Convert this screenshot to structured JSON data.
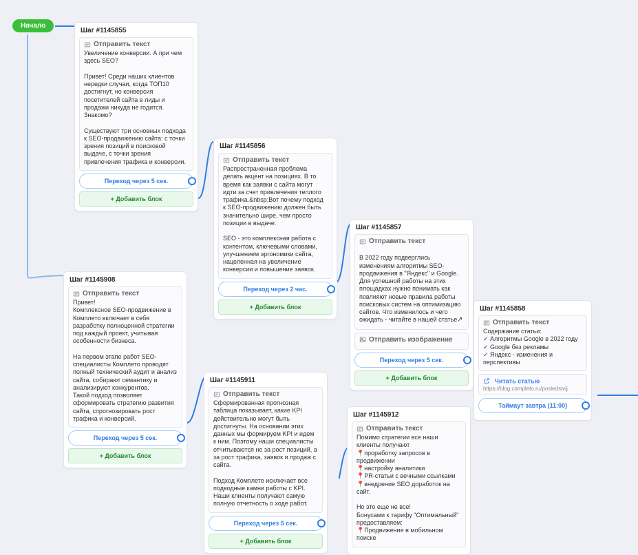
{
  "start_label": "Начало",
  "labels": {
    "send_text": "Отправить текст",
    "send_image": "Отправить изображение",
    "add_block": "+ Добавить блок"
  },
  "steps": {
    "s1145855": {
      "title": "Шаг #1145855",
      "body": "Увеличение конверсии. А при чем здесь SEO?\n\nПривет! Среди наших клиентов нередки случаи, когда ТОП10 достигнут, но конверсия посетителей сайта в лиды и продажи никуда не годится. Знакомо?\n\nСуществуют три основных подхода к SEO-продвижению сайта: с точки зрения позиций в поисковой выдаче, с точки зрения привлечения трафика и конверсии.",
      "transition": "Переход через 5 сек."
    },
    "s1145856": {
      "title": "Шаг #1145856",
      "body": "Распространенная проблема делать акцент на позициях.  В то время как заявки с сайта могут идти за счет привлечения теплого трафика.&nbsp;Вот почему подход к SEO-продвижению должен быть значительно шире, чем просто позиции в выдаче.\n\nSEO - это комплексная работа с контентом, ключевыми словами, улучшением эргономики сайта, нацеленная на  увеличение конверсии и повышение заявок.",
      "transition": "Переход через 2 час."
    },
    "s1145857": {
      "title": "Шаг #1145857",
      "body": "В 2022 году подверглись изменениям алгоритмы SEO-продвижения в \"Яндекс\" и Google.  Для успешной работы на этих площадках нужно понимать как повлияют новые правила работы поисковых систем на оптимизацию сайтов. Что изменилось и чего ожидать - читайте в нашей статье",
      "has_image_block": true,
      "transition": "Переход через 5 сек."
    },
    "s1145858": {
      "title": "Шаг #1145858",
      "body": "Содержание статьи:\n✓ Алгоритмы Google в 2022 году\n✓ Google без рекламы\n✓ Яндекс - изменения и перспективы",
      "link": {
        "title": "Читать статью",
        "url": "https://blog.completo.ru/posledstvij"
      },
      "transition": "Таймаут завтра (11:00)"
    },
    "s1145908": {
      "title": "Шаг #1145908",
      "body": "Привет!\nКомплексное SEO-продвижение в Комплето включает в себя разработку полноценной стратегии под каждый проект, учитывая особенности бизнеса.\n\nНа первом этапе работ SEO-специалисты Комплето проводят полный технический аудит и анализ сайта, собирают семантику и анализируют конкурентов.\nТакой подход позволяет сформировать стратегию развития сайта, спрогнозировать рост трафика и конверсий.",
      "transition": "Переход через 5 сек."
    },
    "s1145911": {
      "title": "Шаг #1145911",
      "body": "Сформированная прогнозная таблица показывает, какие KPI действительно могут быть достигнуты. На основании этих данных мы формируем KPI и идем к ним. Поэтому наши специалисты отчитываются не за рост позиций, а за рост трафика, заявок и продаж с сайта.\n\nПодход Комплето исключает все подводные камни работы с KPI. Наши клиенты получают самую полную отчетность о ходе работ.",
      "transition": "Переход через 5 сек."
    },
    "s1145912": {
      "title": "Шаг #1145912",
      "body_html": "Помимо стратегии все наши клиенты получают\n<span class='marker'>📍</span>проработку запросов в продвижении\n<span class='marker'>📍</span>настройку аналитики\n<span class='marker'>📍</span>PR-статьи с вечными ссылками\n<span class='marker'>📍</span>внедрение SEO доработок на сайт.\n\nНо это еще не все!\nБонусами к тарифу \"Оптимальный\" предоставляем:&nbsp;\n<span class='marker'>📍</span>Продвижение в мобильном поиске"
    }
  }
}
